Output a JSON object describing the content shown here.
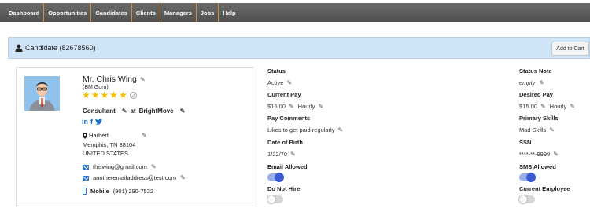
{
  "nav": {
    "items": [
      "Dashboard",
      "Opportunities",
      "Candidates",
      "Clients",
      "Managers",
      "Jobs",
      "Help"
    ]
  },
  "header": {
    "title": "Candidate (82678560)",
    "cart_button": "Add to Cart"
  },
  "candidate": {
    "name": "Mr. Chris Wing",
    "nickname": "(BM Guru)",
    "rating": 5,
    "role": "Consultant",
    "at_label": "at",
    "company": "BrightMove",
    "social": {
      "linkedin": "in",
      "facebook": "f",
      "twitter": "t"
    },
    "address": {
      "line1": "Harbert",
      "line2": "Memphis, TN 38104",
      "line3": "UNITED STATES"
    },
    "emails": [
      "thiswing@gmail.com",
      "anotheremailaddress@test.com"
    ],
    "phone_label": "Mobile",
    "phone": "(901) 290-7522"
  },
  "fields_left": {
    "status": {
      "label": "Status",
      "value": "Active"
    },
    "current_pay": {
      "label": "Current Pay",
      "value": "$16.00",
      "unit": "Hourly"
    },
    "pay_comments": {
      "label": "Pay Comments",
      "value": "Likes to get paid regularly"
    },
    "dob": {
      "label": "Date of Birth",
      "value": "1/22/70"
    },
    "email_allowed": {
      "label": "Email Allowed",
      "on": true
    },
    "do_not_hire": {
      "label": "Do Not Hire",
      "on": false
    }
  },
  "fields_right": {
    "status_note": {
      "label": "Status Note",
      "value": "empty"
    },
    "desired_pay": {
      "label": "Desired Pay",
      "value": "$15.00",
      "unit": "Hourly"
    },
    "primary_skills": {
      "label": "Primary Skills",
      "value": "Mad Skills"
    },
    "ssn": {
      "label": "SSN",
      "value": "****-**-9999"
    },
    "sms_allowed": {
      "label": "SMS Allowed",
      "on": true
    },
    "current_employee": {
      "label": "Current Employee",
      "on": false
    }
  },
  "colors": {
    "nav_bg": "#5a5a5a",
    "header_bg": "#cfe4f7",
    "star": "#f2c200",
    "link_blue": "#2b73c8",
    "toggle_on": "#3a5bd2"
  }
}
